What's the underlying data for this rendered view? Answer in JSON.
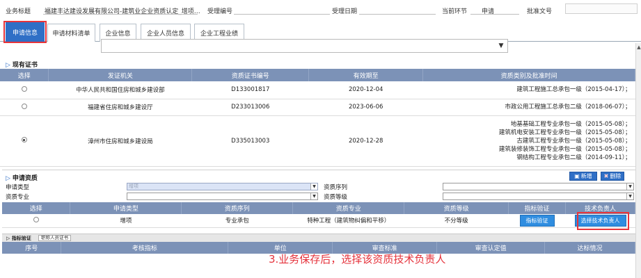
{
  "topbar": {
    "business_title_label": "业务标题",
    "business_title_value": "福建丰达建设发展有限公司-建筑业企业资质认定_增项…",
    "accept_no_label": "受理编号",
    "accept_date_label": "受理日期",
    "current_step_label": "当前环节",
    "current_step_value": "申请",
    "approval_doc_label": "批准文号"
  },
  "tabs": [
    "申请信息",
    "申请材料清单",
    "企业信息",
    "企业人员信息",
    "企业工程业绩"
  ],
  "existing_cert": {
    "title": "现有证书",
    "columns": [
      "选择",
      "发证机关",
      "资质证书编号",
      "有效期至",
      "资质类别及批准时间"
    ],
    "rows": [
      {
        "selected": false,
        "authority": "中华人民共和国住房和城乡建设部",
        "cert_no": "D133001817",
        "valid_until": "2020-12-04",
        "categories": [
          "建筑工程施工总承包一级（2015-04-17）；"
        ]
      },
      {
        "selected": false,
        "authority": "福建省住房和城乡建设厅",
        "cert_no": "D233013006",
        "valid_until": "2023-06-06",
        "categories": [
          "市政公用工程施工总承包二级（2018-06-07）；"
        ]
      },
      {
        "selected": true,
        "authority": "漳州市住房和城乡建设局",
        "cert_no": "D335013003",
        "valid_until": "2020-12-28",
        "categories": [
          "地基基础工程专业承包一级（2015-05-08）；",
          "建筑机电安装工程专业承包一级（2015-05-08）；",
          "古建筑工程专业承包一级（2015-05-08）；",
          "建筑装修装饰工程专业承包一级（2015-05-08）；",
          "钢结构工程专业承包二级（2014-09-11）；"
        ]
      }
    ]
  },
  "apply_qual": {
    "title": "申请资质",
    "add_label": "新增",
    "delete_label": "删除",
    "apply_type_label": "申请类型",
    "apply_type_value": "增项",
    "qual_specialty_label": "资质专业",
    "qual_series_label": "资质序列",
    "qual_level_label": "资质等级",
    "columns": [
      "选择",
      "申请类型",
      "资质序列",
      "资质专业",
      "资质等级",
      "指标验证",
      "技术负责人"
    ],
    "rows": [
      {
        "apply_type": "增项",
        "series": "专业承包",
        "specialty": "特种工程（建筑物纠偏和平移）",
        "level": "不分等级",
        "verify_button": "指标验证",
        "tech_button": "选择技术负责人"
      }
    ]
  },
  "indicator": {
    "title": "指标验证",
    "sub_tab": "职称人员证书",
    "columns": [
      "序号",
      "考核指标",
      "单位",
      "审查标准",
      "审查认定值",
      "达标情况"
    ]
  },
  "annotation": "3.业务保存后，选择该资质技术负责人",
  "colors": {
    "accent": "#2f6fc6",
    "header": "#7c92b7",
    "highlight": "#e8343a"
  }
}
